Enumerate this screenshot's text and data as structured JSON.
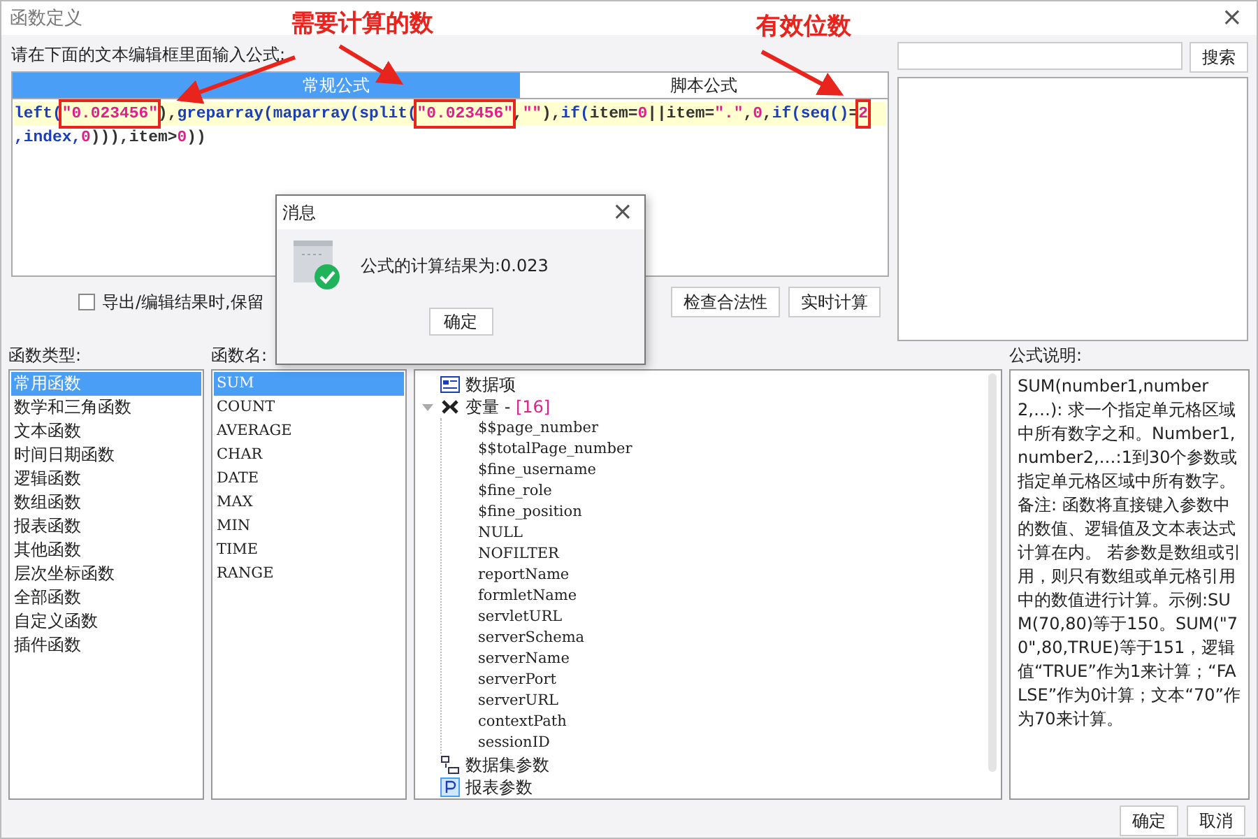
{
  "window": {
    "title": "函数定义",
    "close": "×"
  },
  "prompt": "请在下面的文本编辑框里面输入公式:",
  "tabs": [
    {
      "label": "常规公式",
      "selected": true
    },
    {
      "label": "脚本公式",
      "selected": false
    }
  ],
  "formula": {
    "lines": [
      [
        {
          "text": "left(",
          "kind": "func",
          "boxed": false
        },
        {
          "text": "\"0.023456\"",
          "kind": "string",
          "boxed": true
        },
        {
          "text": "),",
          "kind": "plain",
          "boxed": false
        },
        {
          "text": "greparray(maparray(split(",
          "kind": "func",
          "boxed": false
        },
        {
          "text": "\"0.023456\"",
          "kind": "string",
          "boxed": true
        },
        {
          "text": ",",
          "kind": "plain",
          "boxed": false
        },
        {
          "text": "\"\"",
          "kind": "string",
          "boxed": false
        },
        {
          "text": "),",
          "kind": "plain",
          "boxed": false
        },
        {
          "text": "if(",
          "kind": "func",
          "boxed": false
        },
        {
          "text": "item=",
          "kind": "plain",
          "boxed": false
        },
        {
          "text": "0",
          "kind": "number",
          "boxed": false
        },
        {
          "text": "||item=",
          "kind": "plain",
          "boxed": false
        },
        {
          "text": "\".\"",
          "kind": "string",
          "boxed": false
        },
        {
          "text": ",",
          "kind": "plain",
          "boxed": false
        },
        {
          "text": "0",
          "kind": "number",
          "boxed": false
        },
        {
          "text": ",",
          "kind": "plain",
          "boxed": false
        },
        {
          "text": "if(seq()",
          "kind": "func",
          "boxed": false
        },
        {
          "text": "=",
          "kind": "plain",
          "boxed": false
        },
        {
          "text": "2",
          "kind": "number",
          "boxed": true
        }
      ],
      [
        {
          "text": ",index,",
          "kind": "func",
          "boxed": false
        },
        {
          "text": "0",
          "kind": "number",
          "boxed": false
        },
        {
          "text": "))),item>",
          "kind": "plain",
          "boxed": false
        },
        {
          "text": "0",
          "kind": "number",
          "boxed": false
        },
        {
          "text": "))",
          "kind": "plain",
          "boxed": false
        }
      ]
    ]
  },
  "keep_formula": {
    "label": "导出/编辑结果时,保留",
    "checked": false
  },
  "actions": [
    "检查合法性",
    "实时计算"
  ],
  "search": {
    "button": "搜索"
  },
  "categories": {
    "label": "函数类型:",
    "items": [
      {
        "label": "常用函数",
        "selected": true
      },
      {
        "label": "数学和三角函数",
        "selected": false
      },
      {
        "label": "文本函数",
        "selected": false
      },
      {
        "label": "时间日期函数",
        "selected": false
      },
      {
        "label": "逻辑函数",
        "selected": false
      },
      {
        "label": "数组函数",
        "selected": false
      },
      {
        "label": "报表函数",
        "selected": false
      },
      {
        "label": "其他函数",
        "selected": false
      },
      {
        "label": "层次坐标函数",
        "selected": false
      },
      {
        "label": "全部函数",
        "selected": false
      },
      {
        "label": "自定义函数",
        "selected": false
      },
      {
        "label": "插件函数",
        "selected": false
      }
    ]
  },
  "functions": {
    "label": "函数名:",
    "items": [
      {
        "label": "SUM",
        "selected": true
      },
      {
        "label": "COUNT",
        "selected": false
      },
      {
        "label": "AVERAGE",
        "selected": false
      },
      {
        "label": "CHAR",
        "selected": false
      },
      {
        "label": "DATE",
        "selected": false
      },
      {
        "label": "MAX",
        "selected": false
      },
      {
        "label": "MIN",
        "selected": false
      },
      {
        "label": "TIME",
        "selected": false
      },
      {
        "label": "RANGE",
        "selected": false
      }
    ]
  },
  "tree": [
    {
      "label": "数据项",
      "kind": "data"
    },
    {
      "label": "变量 - ",
      "count": "[16]",
      "kind": "variable",
      "expanded": true,
      "children": [
        {
          "label": "$$page_number"
        },
        {
          "label": "$$totalPage_number"
        },
        {
          "label": "$fine_username"
        },
        {
          "label": "$fine_role"
        },
        {
          "label": "$fine_position"
        },
        {
          "label": "NULL"
        },
        {
          "label": "NOFILTER"
        },
        {
          "label": "reportName"
        },
        {
          "label": "formletName"
        },
        {
          "label": "servletURL"
        },
        {
          "label": "serverSchema"
        },
        {
          "label": "serverName"
        },
        {
          "label": "serverPort"
        },
        {
          "label": "serverURL"
        },
        {
          "label": "contextPath"
        },
        {
          "label": "sessionID"
        }
      ]
    },
    {
      "label": "数据集参数",
      "kind": "dataset"
    },
    {
      "label": "报表参数",
      "kind": "param"
    }
  ],
  "description": {
    "label": "公式说明:",
    "text": "SUM(number1,number2,…): 求一个指定单元格区域中所有数字之和。Number1,number2,…:1到30个参数或指定单元格区域中所有数字。备注:     函数将直接键入参数中的数值、逻辑值及文本表达式计算在内。     若参数是数组或引用，则只有数组或单元格引用中的数值进行计算。示例:SUM(70,80)等于150。SUM(\"70\",80,TRUE)等于151，逻辑值“TRUE”作为1来计算；“FALSE”作为0计算；文本“70”作为70来计算。"
  },
  "footer": [
    "确定",
    "取消"
  ],
  "message": {
    "title": "消息",
    "close": "×",
    "text": "公式的计算结果为:0.023",
    "button": "确定"
  },
  "annotations": [
    {
      "text": "需要计算的数"
    },
    {
      "text": "有效位数"
    }
  ]
}
